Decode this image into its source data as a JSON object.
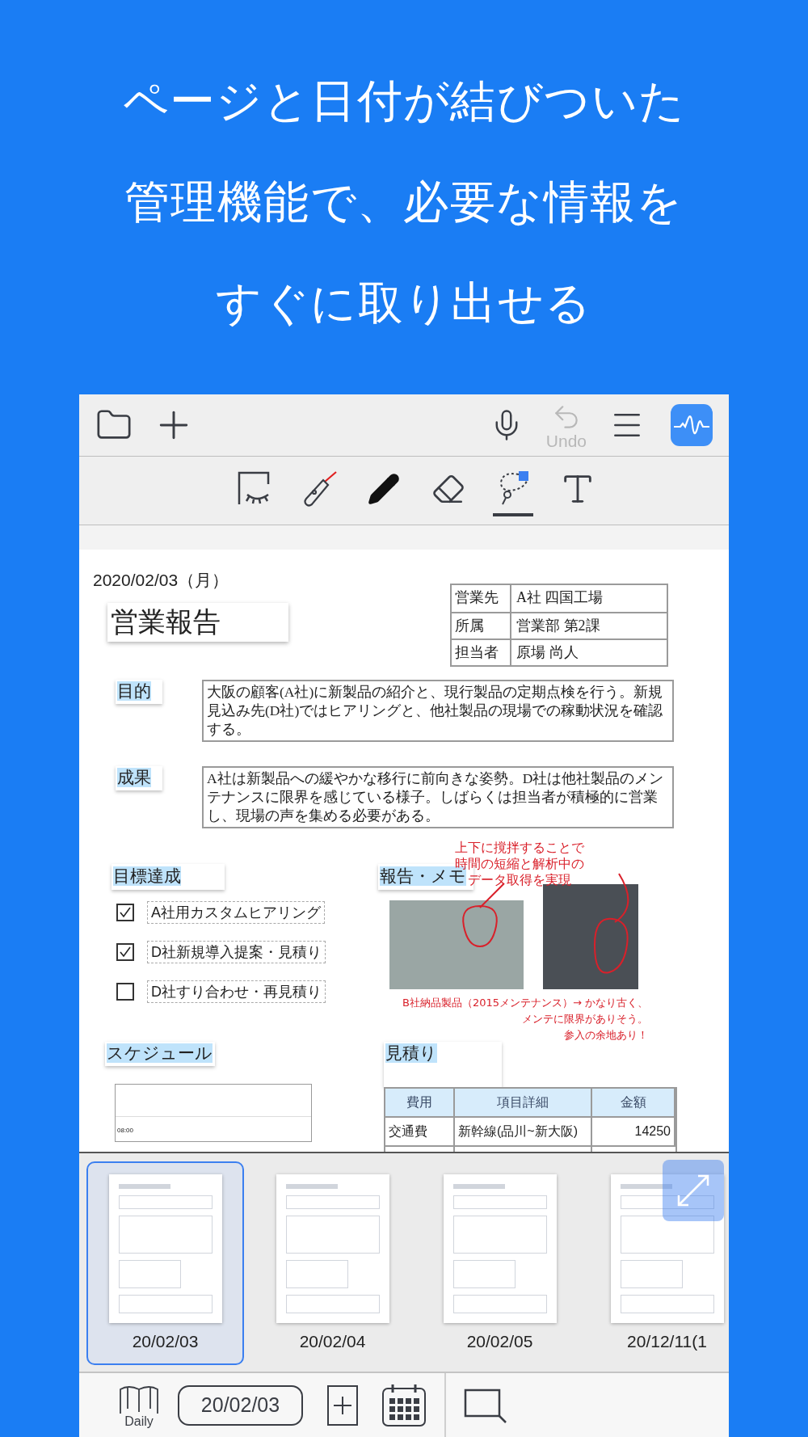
{
  "headline": [
    "ページと日付が結びついた",
    "管理機能で、必要な情報を",
    "すぐに取り出せる"
  ],
  "toolbar": {
    "undo_label": "Undo",
    "undo_disabled": true
  },
  "tools": [
    {
      "kind": "hide",
      "selected": false
    },
    {
      "kind": "laser",
      "selected": false
    },
    {
      "kind": "pen",
      "selected": false
    },
    {
      "kind": "eraser",
      "selected": false
    },
    {
      "kind": "lasso",
      "selected": true
    },
    {
      "kind": "text",
      "selected": false
    }
  ],
  "document": {
    "date": "2020/02/03（月）",
    "title": "営業報告",
    "info_table": [
      {
        "label": "営業先",
        "value": "A社 四国工場"
      },
      {
        "label": "所属",
        "value": "営業部 第2課"
      },
      {
        "label": "担当者",
        "value": "原場 尚人"
      }
    ],
    "sections": [
      {
        "label": "目的",
        "text": "大阪の顧客(A社)に新製品の紹介と、現行製品の定期点検を行う。新規見込み先(D社)ではヒアリングと、他社製品の現場での稼動状況を確認する。"
      },
      {
        "label": "成果",
        "text": "A社は新製品への緩やかな移行に前向きな姿勢。D社は他社製品のメンテナンスに限界を感じている様子。しばらくは担当者が積極的に営業し、現場の声を集める必要がある。"
      }
    ],
    "goals": {
      "heading": "目標達成",
      "items": [
        {
          "label": "A社用カスタムヒアリング",
          "checked": true
        },
        {
          "label": "D社新規導入提案・見積り",
          "checked": true
        },
        {
          "label": "D社すり合わせ・再見積り",
          "checked": false
        }
      ]
    },
    "memo": {
      "heading": "報告・メモ",
      "note_top": [
        "上下に撹拌することで",
        "時間の短縮と解析中の",
        "データ取得を実現"
      ],
      "note_bottom": [
        "B社納品製品（2015メンテナンス）→ かなり古く、",
        "メンテに限界がありそう。",
        "参入の余地あり！"
      ]
    },
    "schedule": {
      "heading": "スケジュール",
      "time": "08:00"
    },
    "estimate": {
      "heading": "見積り",
      "columns": [
        "費用",
        "項目詳細",
        "金額"
      ],
      "rows": [
        [
          "交通費",
          "新幹線(品川~新大阪)",
          "14250"
        ]
      ]
    }
  },
  "thumbnails": [
    {
      "date": "20/02/03",
      "selected": true
    },
    {
      "date": "20/02/04",
      "selected": false
    },
    {
      "date": "20/02/05",
      "selected": false
    },
    {
      "date": "20/12/11(1",
      "selected": false
    }
  ],
  "bottom_bar": {
    "daily_label": "Daily",
    "date": "20/02/03"
  }
}
